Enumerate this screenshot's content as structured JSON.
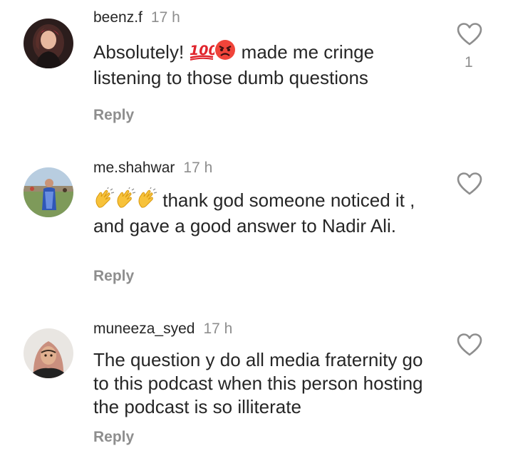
{
  "comments": [
    {
      "username": "beenz.f",
      "time": "17 h",
      "text_before": "Absolutely!",
      "text_after": "made me cringe listening to those dumb questions",
      "emojis": [
        "hundred-points-emoji",
        "angry-face-emoji"
      ],
      "reply_label": "Reply",
      "like_count": "1"
    },
    {
      "username": "me.shahwar",
      "time": "17 h",
      "emojis": [
        "clapping-hands-emoji",
        "clapping-hands-emoji",
        "clapping-hands-emoji"
      ],
      "text": "thank god someone noticed it , and gave a good answer to Nadir Ali.",
      "reply_label": "Reply"
    },
    {
      "username": "muneeza_syed",
      "time": "17 h",
      "text": "The question y do all media fraternity go to this podcast when this person hosting the podcast is so illiterate",
      "reply_label": "Reply"
    }
  ],
  "colors": {
    "text": "#262626",
    "muted": "#8e8e8e",
    "background": "#ffffff"
  }
}
